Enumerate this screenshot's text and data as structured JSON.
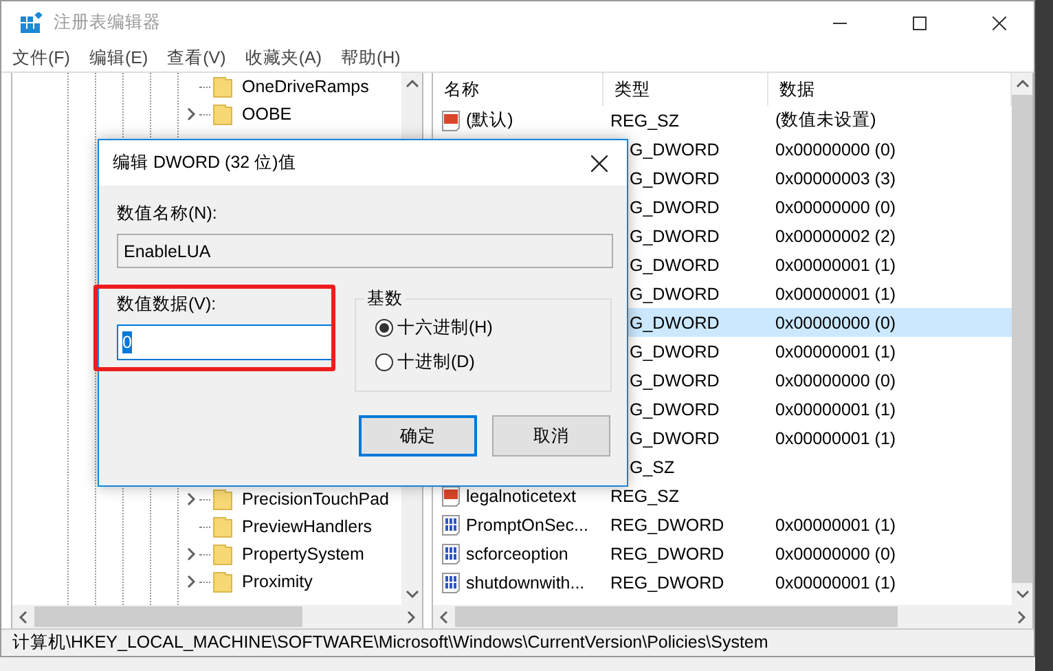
{
  "window": {
    "title": "注册表编辑器"
  },
  "menu": [
    {
      "label": "文件(F)"
    },
    {
      "label": "编辑(E)"
    },
    {
      "label": "查看(V)"
    },
    {
      "label": "收藏夹(A)"
    },
    {
      "label": "帮助(H)"
    }
  ],
  "tree": {
    "top_items": [
      {
        "label": "OneDriveRamps",
        "expandable": false
      },
      {
        "label": "OOBE",
        "expandable": true
      }
    ],
    "bottom_items": [
      {
        "label": "PrecisionTouchPad",
        "expandable": true
      },
      {
        "label": "PreviewHandlers",
        "expandable": false
      },
      {
        "label": "PropertySystem",
        "expandable": true
      },
      {
        "label": "Proximity",
        "expandable": true
      }
    ]
  },
  "list": {
    "columns": [
      "名称",
      "类型",
      "数据"
    ],
    "rows": [
      {
        "kind": "string",
        "name": "(默认)",
        "type": "REG_SZ",
        "data": "(数值未设置)",
        "selected": false
      },
      {
        "kind": "covered",
        "type": "G_DWORD",
        "data": "0x00000000 (0)",
        "selected": false
      },
      {
        "kind": "covered",
        "type": "G_DWORD",
        "data": "0x00000003 (3)",
        "selected": false
      },
      {
        "kind": "covered",
        "type": "G_DWORD",
        "data": "0x00000000 (0)",
        "selected": false
      },
      {
        "kind": "covered",
        "type": "G_DWORD",
        "data": "0x00000002 (2)",
        "selected": false
      },
      {
        "kind": "covered",
        "type": "G_DWORD",
        "data": "0x00000001 (1)",
        "selected": false
      },
      {
        "kind": "covered",
        "type": "G_DWORD",
        "data": "0x00000001 (1)",
        "selected": false
      },
      {
        "kind": "covered",
        "type": "G_DWORD",
        "data": "0x00000000 (0)",
        "selected": true
      },
      {
        "kind": "covered",
        "type": "G_DWORD",
        "data": "0x00000001 (1)",
        "selected": false
      },
      {
        "kind": "covered",
        "type": "G_DWORD",
        "data": "0x00000000 (0)",
        "selected": false
      },
      {
        "kind": "covered",
        "type": "G_DWORD",
        "data": "0x00000001 (1)",
        "selected": false
      },
      {
        "kind": "covered",
        "type": "G_DWORD",
        "data": "0x00000001 (1)",
        "selected": false
      },
      {
        "kind": "covered",
        "type": "G_SZ",
        "selected": false
      },
      {
        "kind": "string",
        "name": "legalnoticetext",
        "type": "REG_SZ",
        "selected": false
      },
      {
        "kind": "dword",
        "name": "PromptOnSec...",
        "type": "REG_DWORD",
        "data": "0x00000001 (1)",
        "selected": false
      },
      {
        "kind": "dword",
        "name": "scforceoption",
        "type": "REG_DWORD",
        "data": "0x00000000 (0)",
        "selected": false
      },
      {
        "kind": "dword",
        "name": "shutdownwith...",
        "type": "REG_DWORD",
        "data": "0x00000001 (1)",
        "selected": false
      }
    ]
  },
  "dialog": {
    "title": "编辑 DWORD (32 位)值",
    "name_label": "数值名称(N):",
    "name_value": "EnableLUA",
    "data_label": "数值数据(V):",
    "data_value": "0",
    "base": {
      "title": "基数",
      "options": [
        {
          "label": "十六进制(H)",
          "selected": true
        },
        {
          "label": "十进制(D)",
          "selected": false
        }
      ]
    },
    "buttons": [
      {
        "label": "确定",
        "default": true
      },
      {
        "label": "取消",
        "default": false
      }
    ]
  },
  "status_bar": "计算机\\HKEY_LOCAL_MACHINE\\SOFTWARE\\Microsoft\\Windows\\CurrentVersion\\Policies\\System"
}
